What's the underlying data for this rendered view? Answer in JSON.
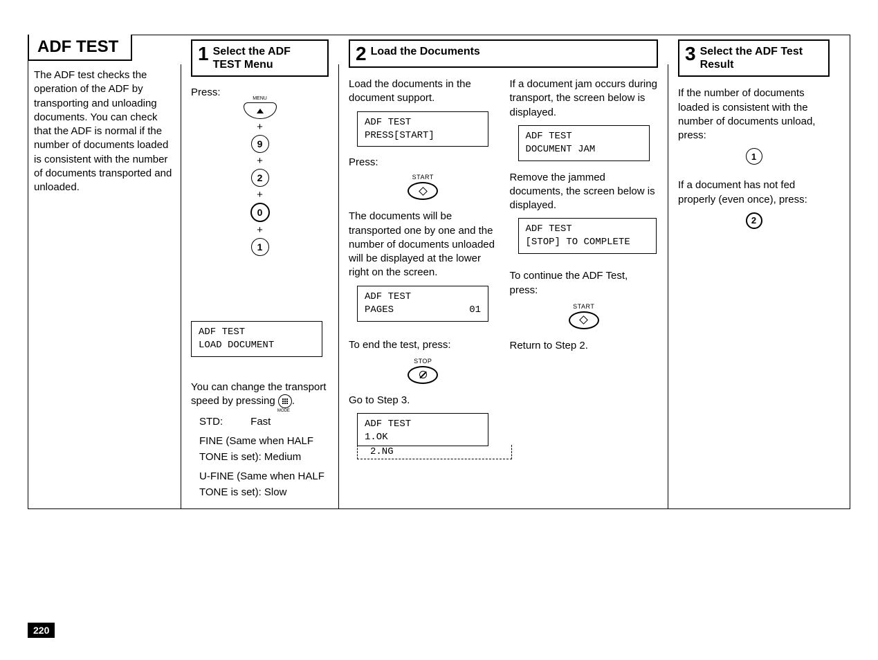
{
  "page": {
    "title": "ADF TEST",
    "number": "220"
  },
  "intro": {
    "text": "The ADF test checks the operation of the ADF by transporting and unloading documents. You can check that the ADF is normal if the number of documents loaded is consistent with the number of documents transported and unloaded."
  },
  "step1": {
    "num": "1",
    "title": "Select the ADF TEST Menu",
    "press_label": "Press:",
    "keys": {
      "k1": "9",
      "k2": "2",
      "k3": "0",
      "k4": "1",
      "plus": "+"
    },
    "lcd": {
      "l1": "ADF TEST",
      "l2": "LOAD DOCUMENT"
    },
    "speed_intro_a": "You can change the transport",
    "speed_intro_b": "speed by pressing ",
    "speed_intro_c": ".",
    "speeds": {
      "s1a": "STD:",
      "s1b": "Fast",
      "s2": "FINE (Same when HALF TONE is set):  Medium",
      "s3": "U-FINE (Same when HALF TONE is set):  Slow"
    }
  },
  "step2": {
    "num": "2",
    "title": "Load the Documents",
    "left": {
      "p1": "Load the documents in the document support.",
      "lcd1": {
        "l1": "ADF TEST",
        "l2": "PRESS[START]"
      },
      "press": "Press:",
      "start_label": "START",
      "p2": "The documents will be transported one by one and the number of documents unloaded will be displayed at the lower right on the screen.",
      "lcd2": {
        "l1": "ADF TEST",
        "l2a": "PAGES",
        "l2b": "01"
      },
      "p3": "To end the test, press:",
      "stop_label": "STOP",
      "goto": "Go to Step 3.",
      "lcd3": {
        "l1": "ADF TEST",
        "opt1": "1.OK",
        "opt2": "2.NG"
      }
    },
    "right": {
      "p1": "If a document jam occurs during transport, the screen below is displayed.",
      "lcd1": {
        "l1": "ADF TEST",
        "l2": "DOCUMENT JAM"
      },
      "p2": "Remove the jammed documents, the screen below is displayed.",
      "lcd2": {
        "l1": "ADF TEST",
        "l2": "[STOP] TO COMPLETE"
      },
      "p3": "To continue the ADF Test, press:",
      "start_label": "START",
      "p4": "Return to Step 2."
    }
  },
  "step3": {
    "num": "3",
    "title": "Select the ADF Test Result",
    "p1": "If the number of documents loaded is consistent with the number of documents unload, press:",
    "key1": "1",
    "p2": "If a document has not fed properly (even once), press:",
    "key2": "2"
  }
}
